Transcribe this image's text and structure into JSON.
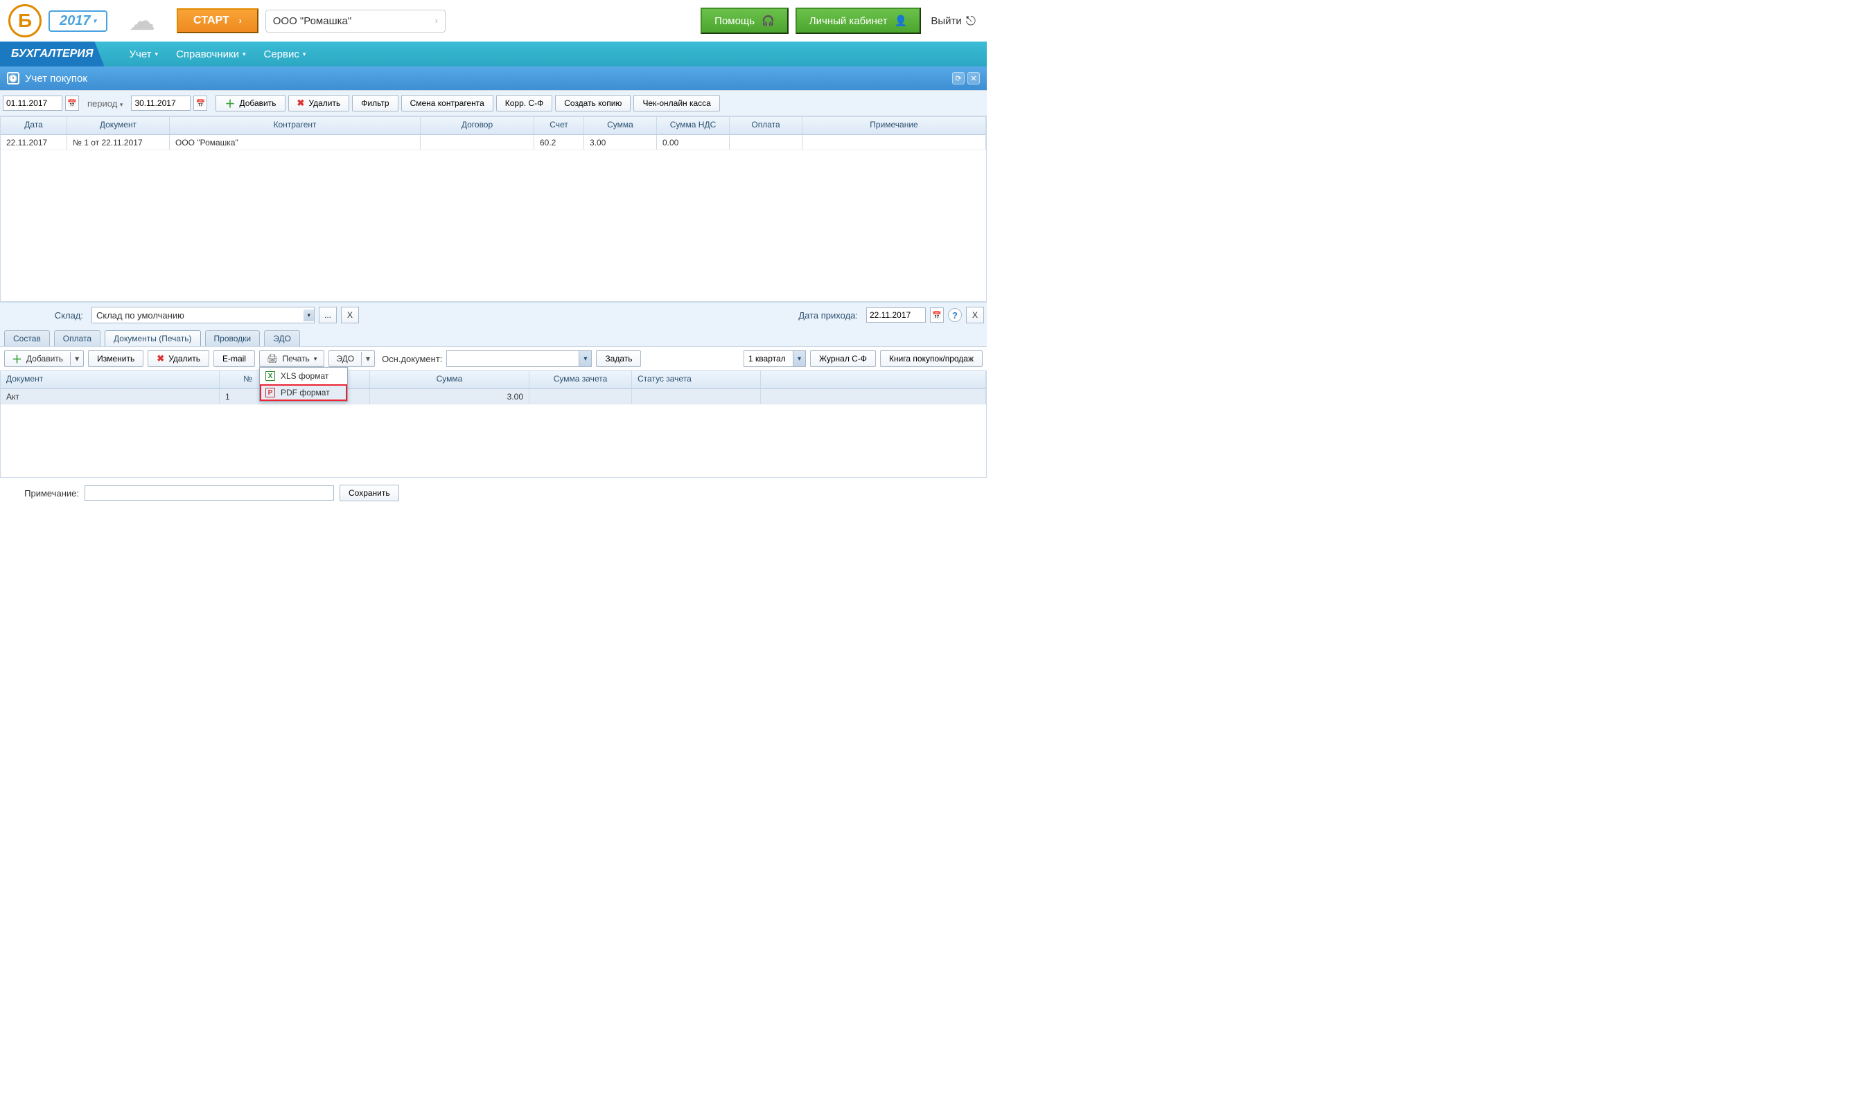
{
  "top": {
    "year": "2017",
    "start_label": "СТАРТ",
    "org_name": "ООО \"Ромашка\"",
    "help_label": "Помощь",
    "cabinet_label": "Личный кабинет",
    "logout_label": "Выйти"
  },
  "nav": {
    "app_title": "БУХГАЛТЕРИЯ",
    "items": [
      "Учет",
      "Справочники",
      "Сервис"
    ]
  },
  "page_title": "Учет покупок",
  "filter": {
    "date_from": "01.11.2017",
    "period_label": "период",
    "date_to": "30.11.2017",
    "add_label": "Добавить",
    "delete_label": "Удалить",
    "filter_label": "Фильтр",
    "change_counterparty_label": "Смена контрагента",
    "corr_sf_label": "Корр. С-Ф",
    "copy_label": "Создать копию",
    "check_online_label": "Чек-онлайн касса"
  },
  "grid": {
    "headers": [
      "Дата",
      "Документ",
      "Контрагент",
      "Договор",
      "Счет",
      "Сумма",
      "Сумма НДС",
      "Оплата",
      "Примечание"
    ],
    "row": {
      "date": "22.11.2017",
      "doc": "№ 1 от 22.11.2017",
      "counterparty": "ООО \"Ромашка\"",
      "contract": "",
      "account": "60.2",
      "sum": "3.00",
      "sum_vat": "0.00",
      "payment": "",
      "note": ""
    }
  },
  "warehouse": {
    "label": "Склад:",
    "value": "Склад по умолчанию",
    "dots": "...",
    "x": "X",
    "arrival_label": "Дата прихода:",
    "arrival_date": "22.11.2017",
    "help": "?",
    "x2": "X"
  },
  "tabs": [
    "Состав",
    "Оплата",
    "Документы (Печать)",
    "Проводки",
    "ЭДО"
  ],
  "active_tab_index": 2,
  "sub": {
    "add_label": "Добавить",
    "edit_label": "Изменить",
    "delete_label": "Удалить",
    "email_label": "E-mail",
    "print_label": "Печать",
    "edo_label": "ЭДО",
    "main_doc_label": "Осн.документ:",
    "set_label": "Задать",
    "quarter_value": "1 квартал",
    "journal_label": "Журнал С-Ф",
    "purchase_book_label": "Книга покупок/продаж"
  },
  "print_menu": {
    "xls": "XLS формат",
    "pdf": "PDF формат"
  },
  "grid2": {
    "headers": [
      "Документ",
      "№",
      "",
      "Сумма",
      "Сумма зачета",
      "Статус зачета",
      ""
    ],
    "row": {
      "doc": "Акт",
      "num": "1",
      "sum": "3.00"
    }
  },
  "note": {
    "label": "Примечание:",
    "save_label": "Сохранить"
  }
}
